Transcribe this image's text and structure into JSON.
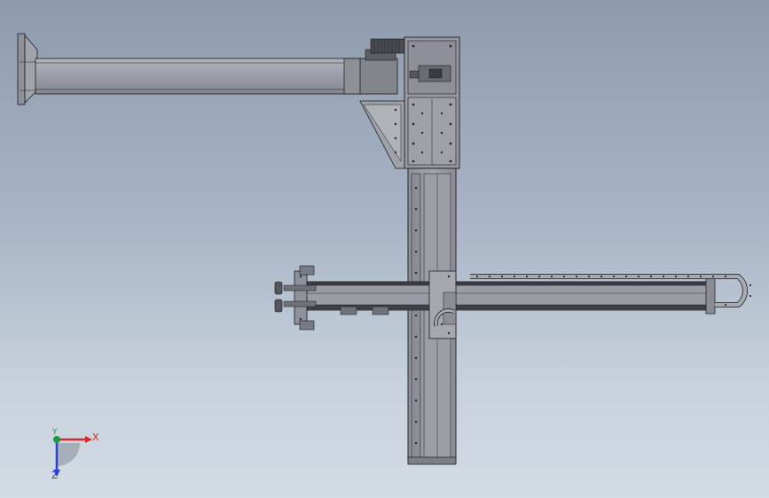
{
  "viewport": {
    "background_top": "#8e9bad",
    "background_bottom": "#d3dbe4"
  },
  "model": {
    "part_color": "#9a9ca6",
    "part_dark": "#6e7078",
    "edge_color": "#1a1a1a",
    "chain_color": "#a8aab2"
  },
  "triad": {
    "x_label": "X",
    "y_label": "Y",
    "z_label": "Z",
    "x_color": "#d42a2a",
    "y_color": "#1d9a3c",
    "z_color": "#2a3fd4"
  }
}
